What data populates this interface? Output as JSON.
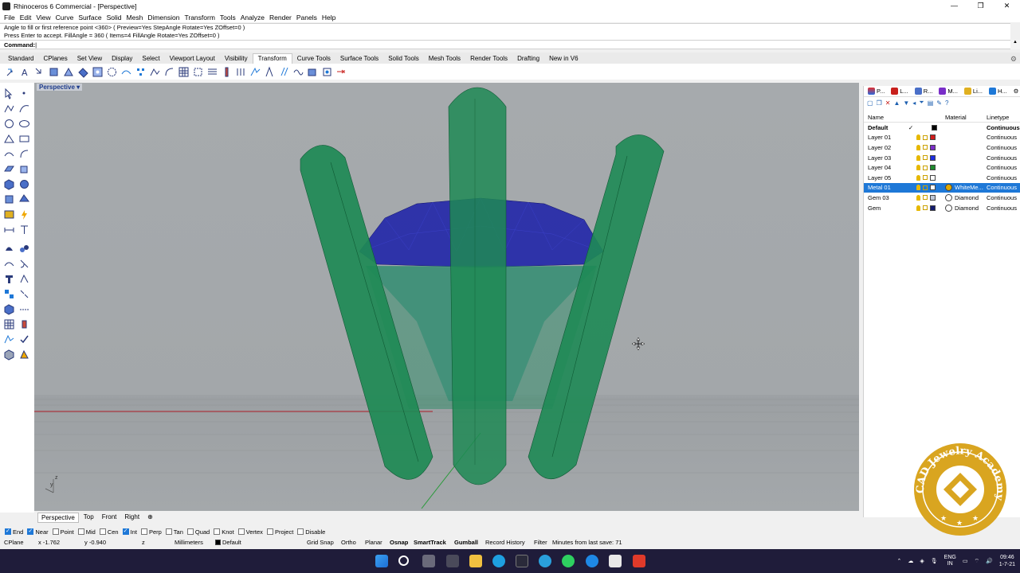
{
  "window": {
    "title": "Rhinoceros 6 Commercial - [Perspective]",
    "min": "—",
    "max": "❐",
    "close": "✕"
  },
  "menu": [
    "File",
    "Edit",
    "View",
    "Curve",
    "Surface",
    "Solid",
    "Mesh",
    "Dimension",
    "Transform",
    "Tools",
    "Analyze",
    "Render",
    "Panels",
    "Help"
  ],
  "command": {
    "history1": "Angle to fill or first reference point <360> ( Preview=Yes  StepAngle  Rotate=Yes  ZOffset=0 )",
    "history2": "Press Enter to accept. FillAngle = 360 ( Items=4  FillAngle  Rotate=Yes  ZOffset=0 )",
    "prompt": "Command:"
  },
  "toolbar_tabs": [
    "Standard",
    "CPlanes",
    "Set View",
    "Display",
    "Select",
    "Viewport Layout",
    "Visibility",
    "Transform",
    "Curve Tools",
    "Surface Tools",
    "Solid Tools",
    "Mesh Tools",
    "Render Tools",
    "Drafting",
    "New in V6"
  ],
  "active_tab": "Transform",
  "viewport": {
    "label": "Perspective",
    "tabs": [
      "Perspective",
      "Top",
      "Front",
      "Right"
    ],
    "add": "⊕",
    "axis_z": "z",
    "axis_y": "y"
  },
  "panel": {
    "tabs": [
      "P...",
      "L...",
      "R...",
      "M...",
      "Li...",
      "H..."
    ],
    "headers": {
      "name": "Name",
      "material": "Material",
      "linetype": "Linetype"
    },
    "layers": [
      {
        "name": "Default",
        "check": "✓",
        "color": "#000000",
        "material": "",
        "linetype": "Continuous",
        "bold": true
      },
      {
        "name": "Layer 01",
        "check": "",
        "color": "#d01c1c",
        "material": "",
        "linetype": "Continuous"
      },
      {
        "name": "Layer 02",
        "check": "",
        "color": "#7a2ec8",
        "material": "",
        "linetype": "Continuous"
      },
      {
        "name": "Layer 03",
        "check": "",
        "color": "#1d2ee0",
        "material": "",
        "linetype": "Continuous"
      },
      {
        "name": "Layer 04",
        "check": "",
        "color": "#1e8a2e",
        "material": "",
        "linetype": "Continuous"
      },
      {
        "name": "Layer 05",
        "check": "",
        "color": "#ffffff",
        "material": "",
        "linetype": "Continuous"
      },
      {
        "name": "Metal 01",
        "check": "",
        "color": "#ffffff",
        "material": "WhiteMe...",
        "material_color": "#e0a800",
        "linetype": "Continuous",
        "selected": true
      },
      {
        "name": "Gem 03",
        "check": "",
        "color": "#bfc7d6",
        "material": "Diamond",
        "material_color": "#ffffff",
        "linetype": "Continuous"
      },
      {
        "name": "Gem",
        "check": "",
        "color": "#141c6e",
        "material": "Diamond",
        "material_color": "#ffffff",
        "linetype": "Continuous"
      }
    ]
  },
  "osnap": [
    {
      "label": "End",
      "on": true
    },
    {
      "label": "Near",
      "on": true
    },
    {
      "label": "Point",
      "on": false
    },
    {
      "label": "Mid",
      "on": false
    },
    {
      "label": "Cen",
      "on": false
    },
    {
      "label": "Int",
      "on": true
    },
    {
      "label": "Perp",
      "on": false
    },
    {
      "label": "Tan",
      "on": false
    },
    {
      "label": "Quad",
      "on": false
    },
    {
      "label": "Knot",
      "on": false
    },
    {
      "label": "Vertex",
      "on": false
    },
    {
      "label": "Project",
      "on": false
    },
    {
      "label": "Disable",
      "on": false
    }
  ],
  "status": {
    "cplane": "CPlane",
    "x": "x -1.762",
    "y": "y -0.940",
    "z": "z",
    "units": "Millimeters",
    "layer": "Default",
    "grid_snap": "Grid Snap",
    "ortho": "Ortho",
    "planar": "Planar",
    "osnap": "Osnap",
    "smarttrack": "SmartTrack",
    "gumball": "Gumball",
    "record": "Record History",
    "filter": "Filter",
    "save": "Minutes from last save: 71"
  },
  "taskbar": {
    "lang1": "ENG",
    "lang2": "IN",
    "time": "09:46",
    "date": "1-7-21"
  },
  "logo": {
    "text": "CAD Jewelry Academy",
    "accent": "#d9a520"
  },
  "colors": {
    "selection": "#1e78d7",
    "prong": "#1e8a55",
    "gem": "#1a1fa8"
  }
}
